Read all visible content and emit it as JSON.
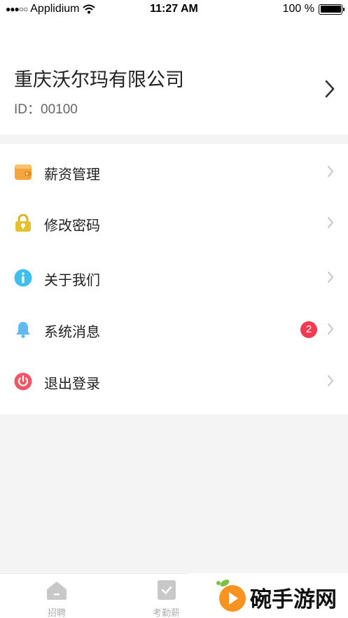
{
  "status_bar": {
    "carrier": "Applidium",
    "time": "11:27 AM",
    "battery": "100 %"
  },
  "profile": {
    "company_name": "重庆沃尔玛有限公司",
    "id_text": "ID：00100"
  },
  "menu": {
    "items": [
      {
        "label": "薪资管理",
        "icon": "wallet-icon",
        "color": "#f6a53c"
      },
      {
        "label": "修改密码",
        "icon": "lock-icon",
        "color": "#e4c22f"
      },
      {
        "label": "关于我们",
        "icon": "info-icon",
        "color": "#3fc0ec"
      },
      {
        "label": "系统消息",
        "icon": "bell-icon",
        "color": "#61b9f2",
        "badge": "2"
      },
      {
        "label": "退出登录",
        "icon": "power-icon",
        "color": "#f15566"
      }
    ]
  },
  "tabbar": {
    "tabs": [
      {
        "label": "招聘",
        "icon": "home-icon"
      },
      {
        "label": "考勤薪",
        "icon": "checklist-icon"
      }
    ]
  },
  "watermark": {
    "text": "碗手游网"
  },
  "colors": {
    "badge": "#f23b52",
    "watermark_orange": "#f7931e",
    "watermark_green": "#7cc242"
  }
}
